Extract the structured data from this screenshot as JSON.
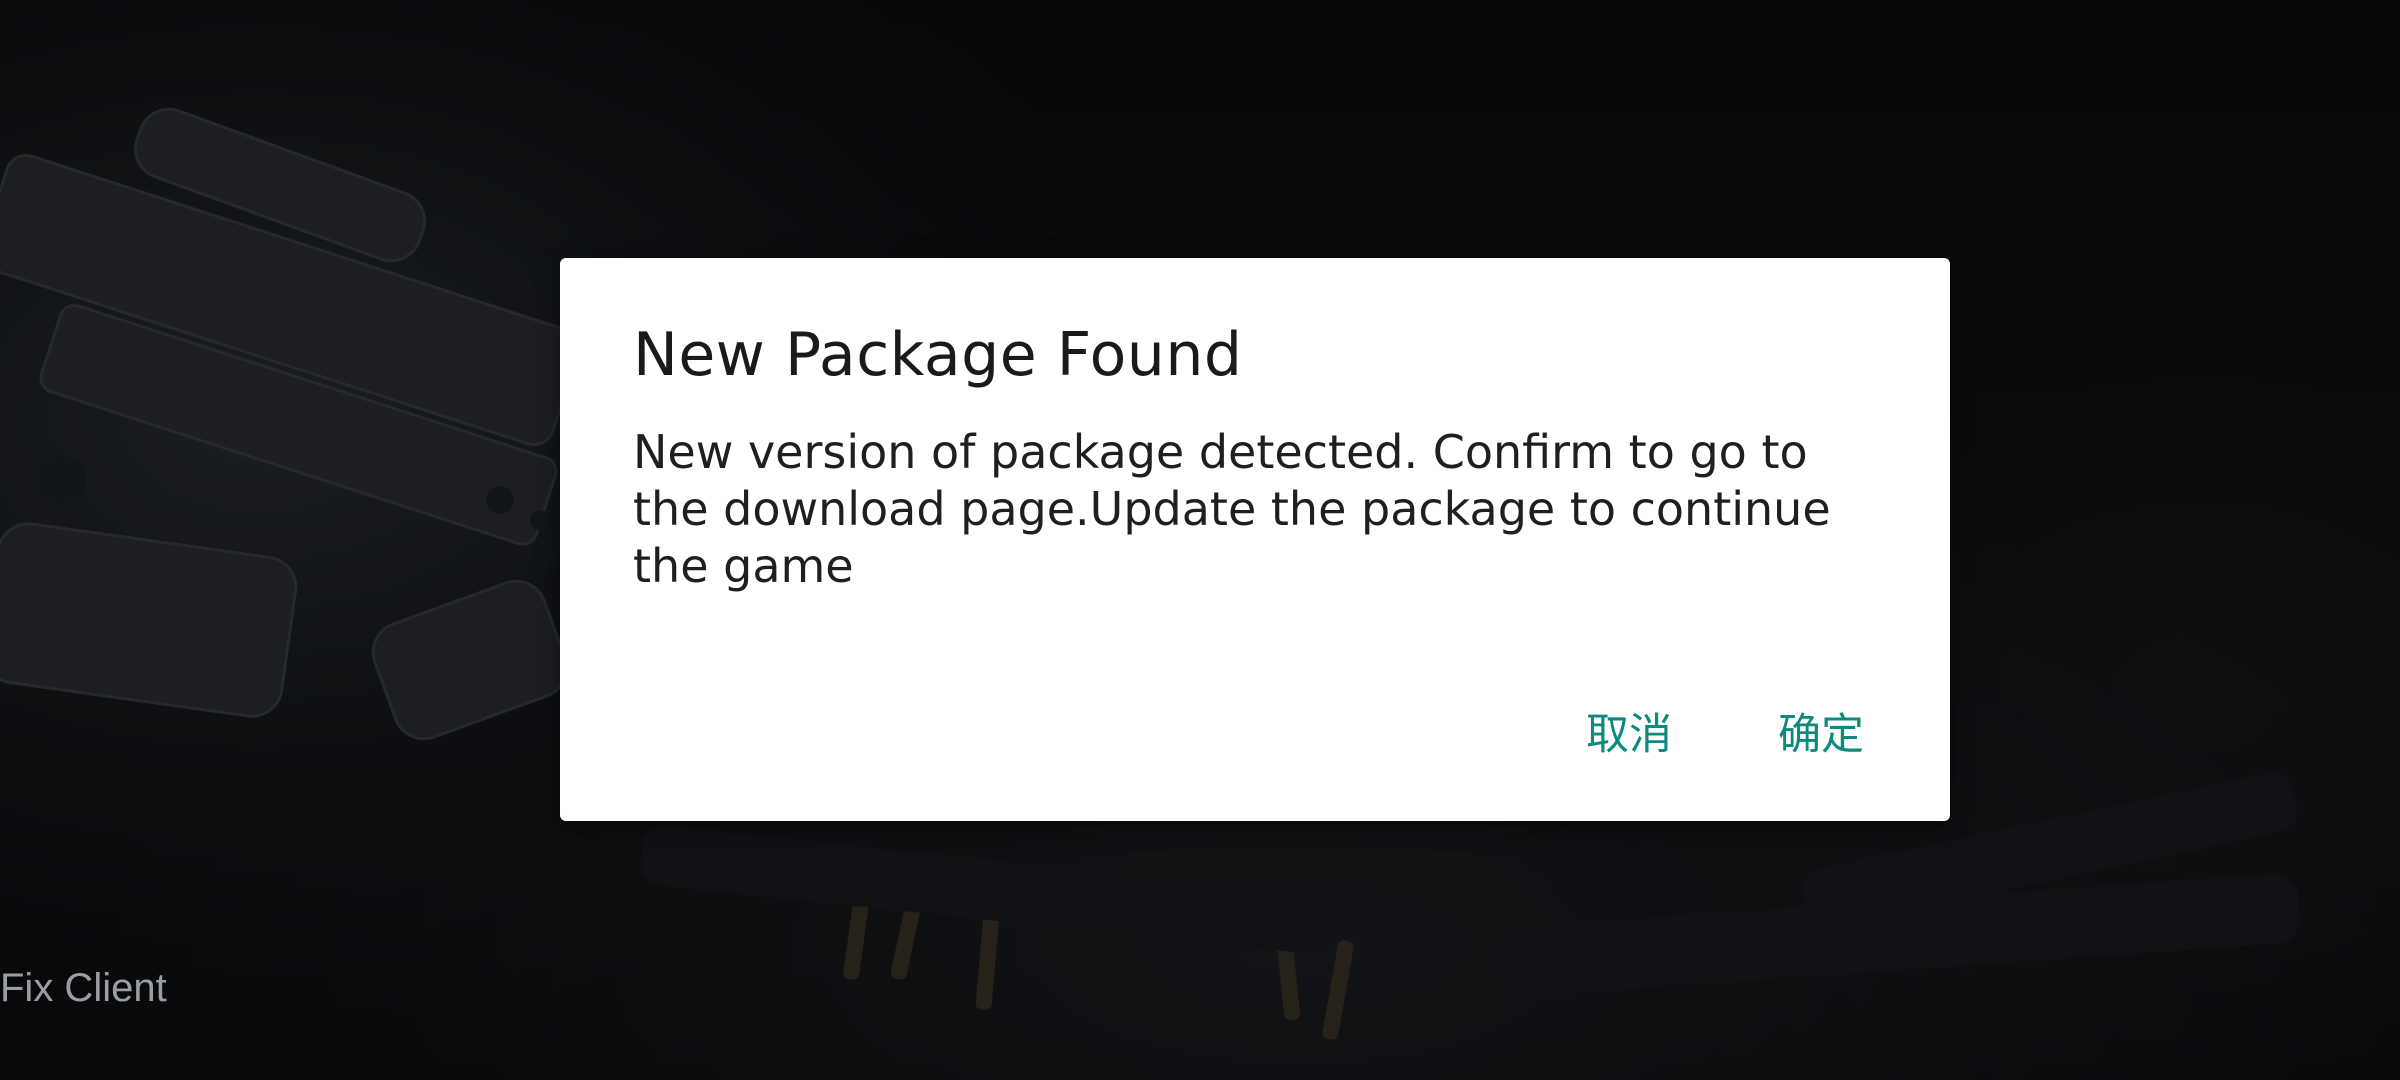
{
  "dialog": {
    "title": "New Package Found",
    "message": "New version of package detected. Confirm to go to the download page.Update the package to continue the game",
    "cancel_label": "取消",
    "confirm_label": "确定"
  },
  "footer": {
    "fix_client_label": "Fix Client"
  },
  "colors": {
    "accent": "#0d8a7e",
    "dialog_bg": "#ffffff",
    "backdrop": "#0b0d10"
  }
}
